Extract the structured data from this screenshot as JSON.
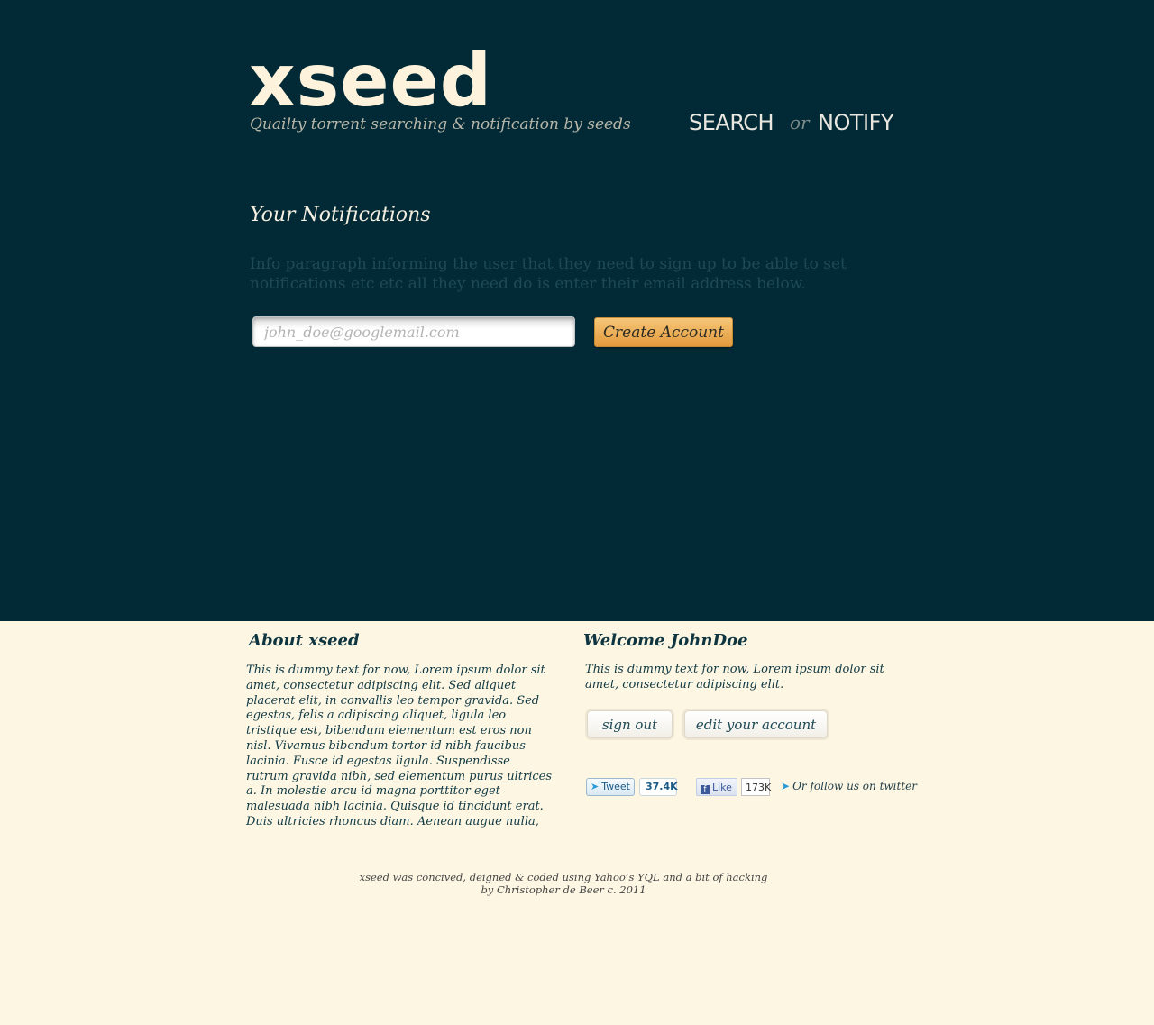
{
  "header": {
    "logo": "xseed",
    "tagline": "Quailty torrent searching & notification by seeds",
    "nav": {
      "search": "SEARCH",
      "or": "or",
      "notify": "NOTIFY"
    }
  },
  "main": {
    "title": "Your Notifications",
    "info": "Info paragraph informing the user that they need to sign up to be able to set notifications etc etc all they need do is enter their email address below.",
    "email_placeholder": "john_doe@googlemail.com",
    "create_label": "Create Account"
  },
  "about": {
    "title": "About xseed",
    "text": "This is dummy text for now, Lorem ipsum dolor sit amet, consectetur adipiscing elit. Sed aliquet placerat elit, in convallis leo tempor gravida. Sed egestas, felis a adipiscing aliquet, ligula leo tristique est, bibendum elementum est eros non nisl. Vivamus bibendum tortor id nibh faucibus lacinia. Fusce id egestas ligula. Suspendisse rutrum gravida nibh, sed elementum purus ultrices a. In molestie arcu id magna porttitor eget malesuada nibh lacinia. Quisque id tincidunt erat. Duis ultricies rhoncus diam. Aenean augue nulla,"
  },
  "welcome": {
    "title": "Welcome JohnDoe",
    "text": "This is dummy text for now, Lorem ipsum dolor sit amet, consectetur adipiscing elit.",
    "signout_label": "sign out",
    "edit_label": "edit your account"
  },
  "social": {
    "tweet_label": "Tweet",
    "tweet_count": "37.4K",
    "like_label": "Like",
    "like_count": "173K",
    "follow_text": "Or follow us on twitter"
  },
  "footer": {
    "line1": "xseed was concived, deigned & coded using Yahoo’s YQL and a bit of hacking",
    "line2": "by Christopher de Beer c. 2011"
  }
}
